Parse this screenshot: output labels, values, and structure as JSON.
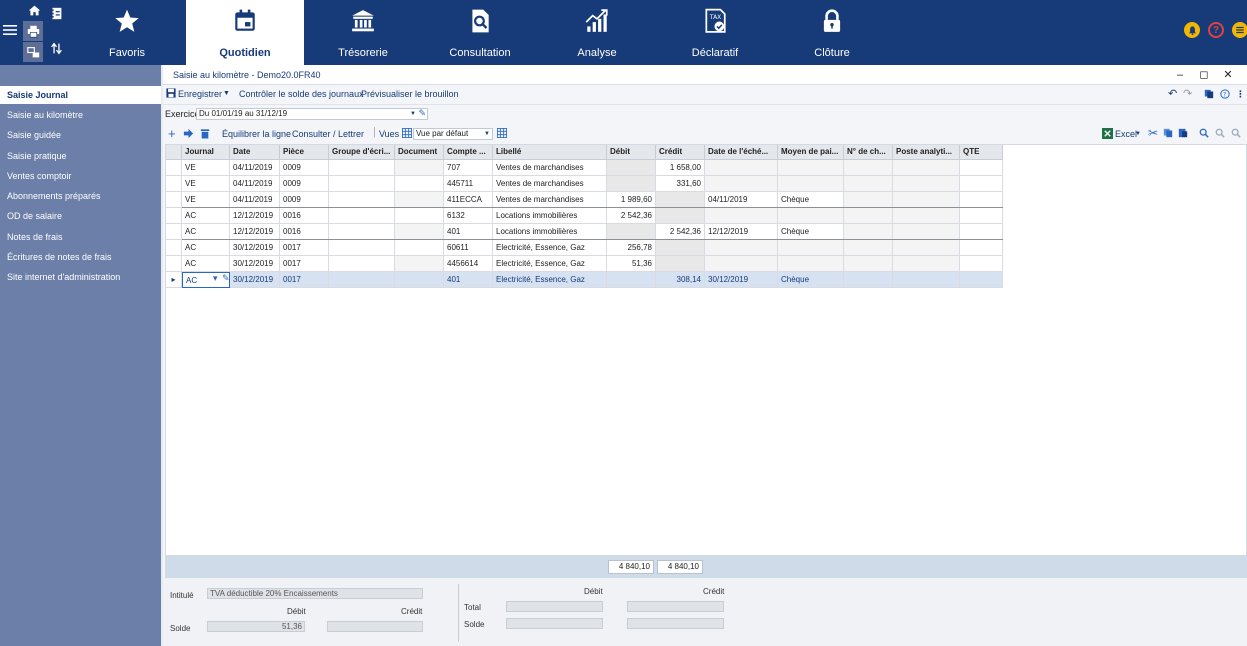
{
  "nav": {
    "tabs": [
      {
        "label": "Favoris",
        "icon": "star-icon"
      },
      {
        "label": "Quotidien",
        "icon": "calendar-icon",
        "active": true
      },
      {
        "label": "Trésorerie",
        "icon": "bank-icon"
      },
      {
        "label": "Consultation",
        "icon": "document-search-icon"
      },
      {
        "label": "Analyse",
        "icon": "chart-icon"
      },
      {
        "label": "Déclaratif",
        "icon": "tax-icon"
      },
      {
        "label": "Clôture",
        "icon": "lock-icon"
      }
    ]
  },
  "sidebar": {
    "items": [
      {
        "label": "Saisie Journal",
        "active": true
      },
      {
        "label": "Saisie au kilomètre"
      },
      {
        "label": "Saisie guidée"
      },
      {
        "label": "Saisie pratique"
      },
      {
        "label": "Ventes comptoir"
      },
      {
        "label": "Abonnements préparés"
      },
      {
        "label": "OD de salaire"
      },
      {
        "label": "Notes de frais"
      },
      {
        "label": "Écritures de notes de frais"
      },
      {
        "label": "Site internet d'administration"
      }
    ]
  },
  "window": {
    "title": "Saisie au kilomètre - Demo20.0FR40"
  },
  "toolbar": {
    "save_label": "Enregistrer",
    "check_label": "Contrôler le solde des journaux",
    "preview_label": "Prévisualiser le brouillon"
  },
  "exercice": {
    "label": "Exercice",
    "value": "Du 01/01/19 au 31/12/19"
  },
  "toolbar2": {
    "balance_label": "Équilibrer la ligne",
    "consult_label": "Consulter / Lettrer",
    "views_label": "Vues",
    "view_value": "Vue par défaut",
    "excel_label": "Excel"
  },
  "grid": {
    "columns": [
      "Journal",
      "Date",
      "Pièce",
      "Groupe d'écri...",
      "Document",
      "Compte ...",
      "Libellé",
      "Débit",
      "Crédit",
      "Date de l'éché...",
      "Moyen de pai...",
      "N° de ch...",
      "Poste analyti...",
      "QTE"
    ],
    "rows": [
      [
        "VE",
        "04/11/2019",
        "0009",
        "",
        "",
        "707",
        "Ventes de marchandises",
        "",
        "1 658,00",
        "",
        "",
        "",
        "",
        ""
      ],
      [
        "VE",
        "04/11/2019",
        "0009",
        "",
        "",
        "445711",
        "Ventes de marchandises",
        "",
        "331,60",
        "",
        "",
        "",
        "",
        ""
      ],
      [
        "VE",
        "04/11/2019",
        "0009",
        "",
        "",
        "411ECCA",
        "Ventes de marchandises",
        "1 989,60",
        "",
        "04/11/2019",
        "Chèque",
        "",
        "",
        ""
      ],
      [
        "AC",
        "12/12/2019",
        "0016",
        "",
        "",
        "6132",
        "Locations immobilières",
        "2 542,36",
        "",
        "",
        "",
        "",
        "",
        ""
      ],
      [
        "AC",
        "12/12/2019",
        "0016",
        "",
        "",
        "401",
        "Locations immobilières",
        "",
        "2 542,36",
        "12/12/2019",
        "Chèque",
        "",
        "",
        ""
      ],
      [
        "AC",
        "30/12/2019",
        "0017",
        "",
        "",
        "60611",
        "Electricité, Essence, Gaz",
        "256,78",
        "",
        "",
        "",
        "",
        "",
        ""
      ],
      [
        "AC",
        "30/12/2019",
        "0017",
        "",
        "",
        "4456614",
        "Electricité, Essence, Gaz",
        "51,36",
        "",
        "",
        "",
        "",
        "",
        ""
      ],
      [
        "AC",
        "30/12/2019",
        "0017",
        "",
        "",
        "401",
        "Electricité, Essence, Gaz",
        "",
        "308,14",
        "30/12/2019",
        "Chèque",
        "",
        "",
        ""
      ]
    ]
  },
  "totals": {
    "debit": "4 840,10",
    "credit": "4 840,10"
  },
  "bottom": {
    "intitule_label": "Intitulé",
    "intitule_value": "TVA déductible 20% Encaissements",
    "debit_label": "Débit",
    "credit_label": "Crédit",
    "solde_label": "Solde",
    "solde_debit": "51,36",
    "total_label": "Total",
    "right_debit_label": "Débit",
    "right_credit_label": "Crédit",
    "right_solde_label": "Solde"
  }
}
